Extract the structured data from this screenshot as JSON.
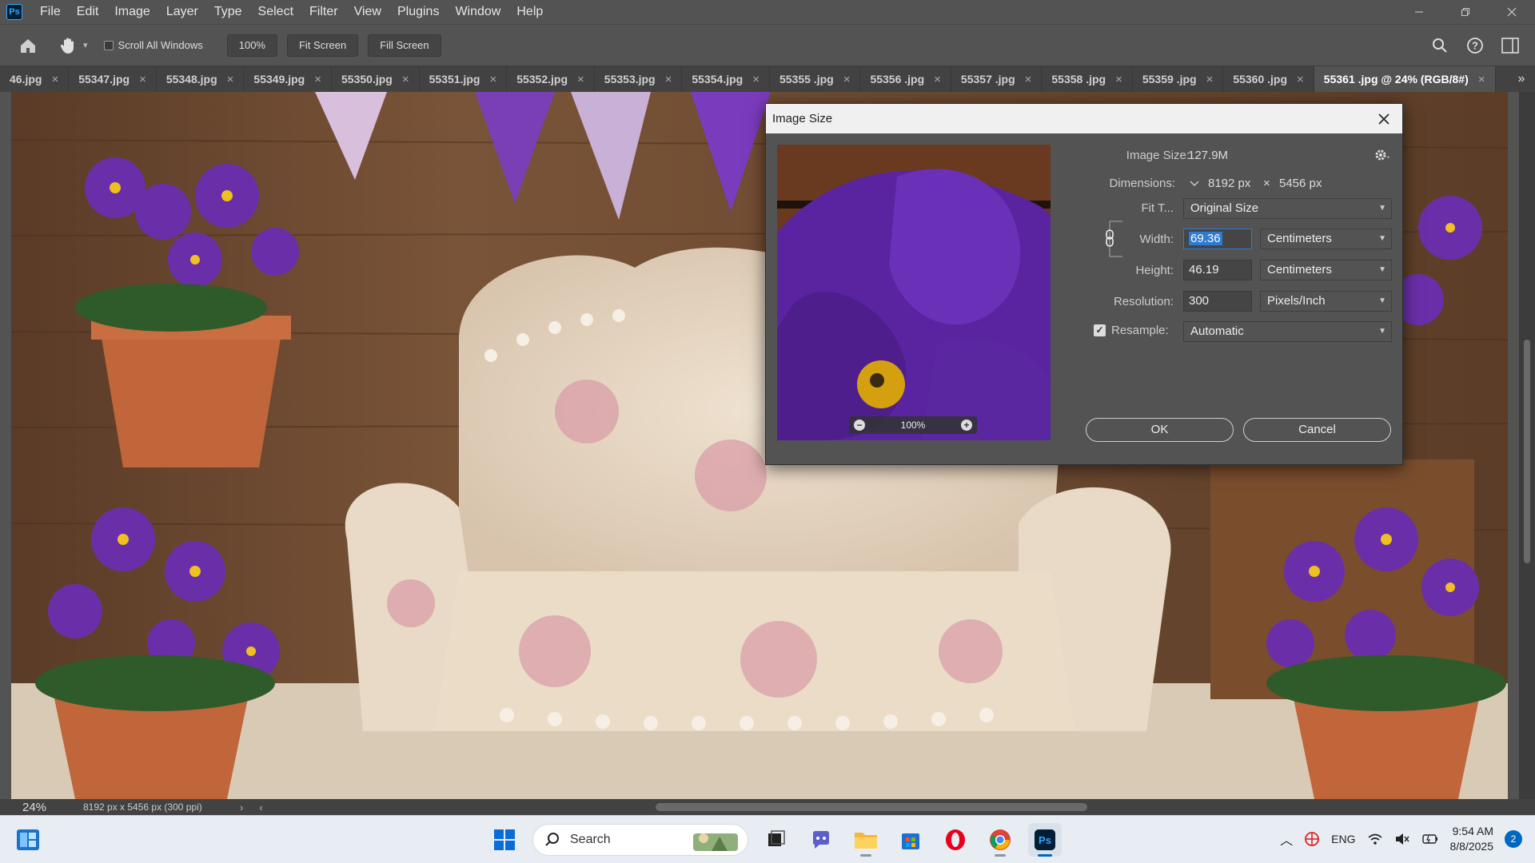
{
  "app": {
    "logo": "Ps",
    "menu": [
      "File",
      "Edit",
      "Image",
      "Layer",
      "Type",
      "Select",
      "Filter",
      "View",
      "Plugins",
      "Window",
      "Help"
    ]
  },
  "options": {
    "scroll_all_windows": "Scroll All Windows",
    "zoom_100": "100%",
    "fit_screen": "Fit Screen",
    "fill_screen": "Fill Screen"
  },
  "tabs": [
    {
      "label": "46.jpg"
    },
    {
      "label": "55347.jpg"
    },
    {
      "label": "55348.jpg"
    },
    {
      "label": "55349.jpg"
    },
    {
      "label": "55350.jpg"
    },
    {
      "label": "55351.jpg"
    },
    {
      "label": "55352.jpg"
    },
    {
      "label": "55353.jpg"
    },
    {
      "label": "55354.jpg"
    },
    {
      "label": "55355 .jpg"
    },
    {
      "label": "55356 .jpg"
    },
    {
      "label": "55357 .jpg"
    },
    {
      "label": "55358 .jpg"
    },
    {
      "label": "55359 .jpg"
    },
    {
      "label": "55360 .jpg"
    },
    {
      "label": "55361 .jpg @ 24% (RGB/8#)"
    }
  ],
  "status": {
    "zoom": "24%",
    "doc_info": "8192 px x 5456 px (300 ppi)"
  },
  "dialog": {
    "title": "Image Size",
    "image_size_label": "Image Size:",
    "image_size_value": "127.9M",
    "dimensions_label": "Dimensions:",
    "dim_width": "8192 px",
    "dim_x": "×",
    "dim_height": "5456 px",
    "fit_label": "Fit T...",
    "fit_value": "Original Size",
    "width_label": "Width:",
    "width_value": "69.36",
    "width_unit": "Centimeters",
    "height_label": "Height:",
    "height_value": "46.19",
    "height_unit": "Centimeters",
    "resolution_label": "Resolution:",
    "resolution_value": "300",
    "resolution_unit": "Pixels/Inch",
    "resample_label": "Resample:",
    "resample_value": "Automatic",
    "preview_zoom": "100%",
    "ok": "OK",
    "cancel": "Cancel"
  },
  "taskbar": {
    "search": "Search",
    "lang": "ENG",
    "time": "9:54 AM",
    "date": "8/8/2025",
    "notifications": "2"
  },
  "colors": {
    "ps_bg": "#535353",
    "tab_bg": "#424242",
    "accent": "#2d7bd2",
    "taskbar": "#e8edf3"
  }
}
